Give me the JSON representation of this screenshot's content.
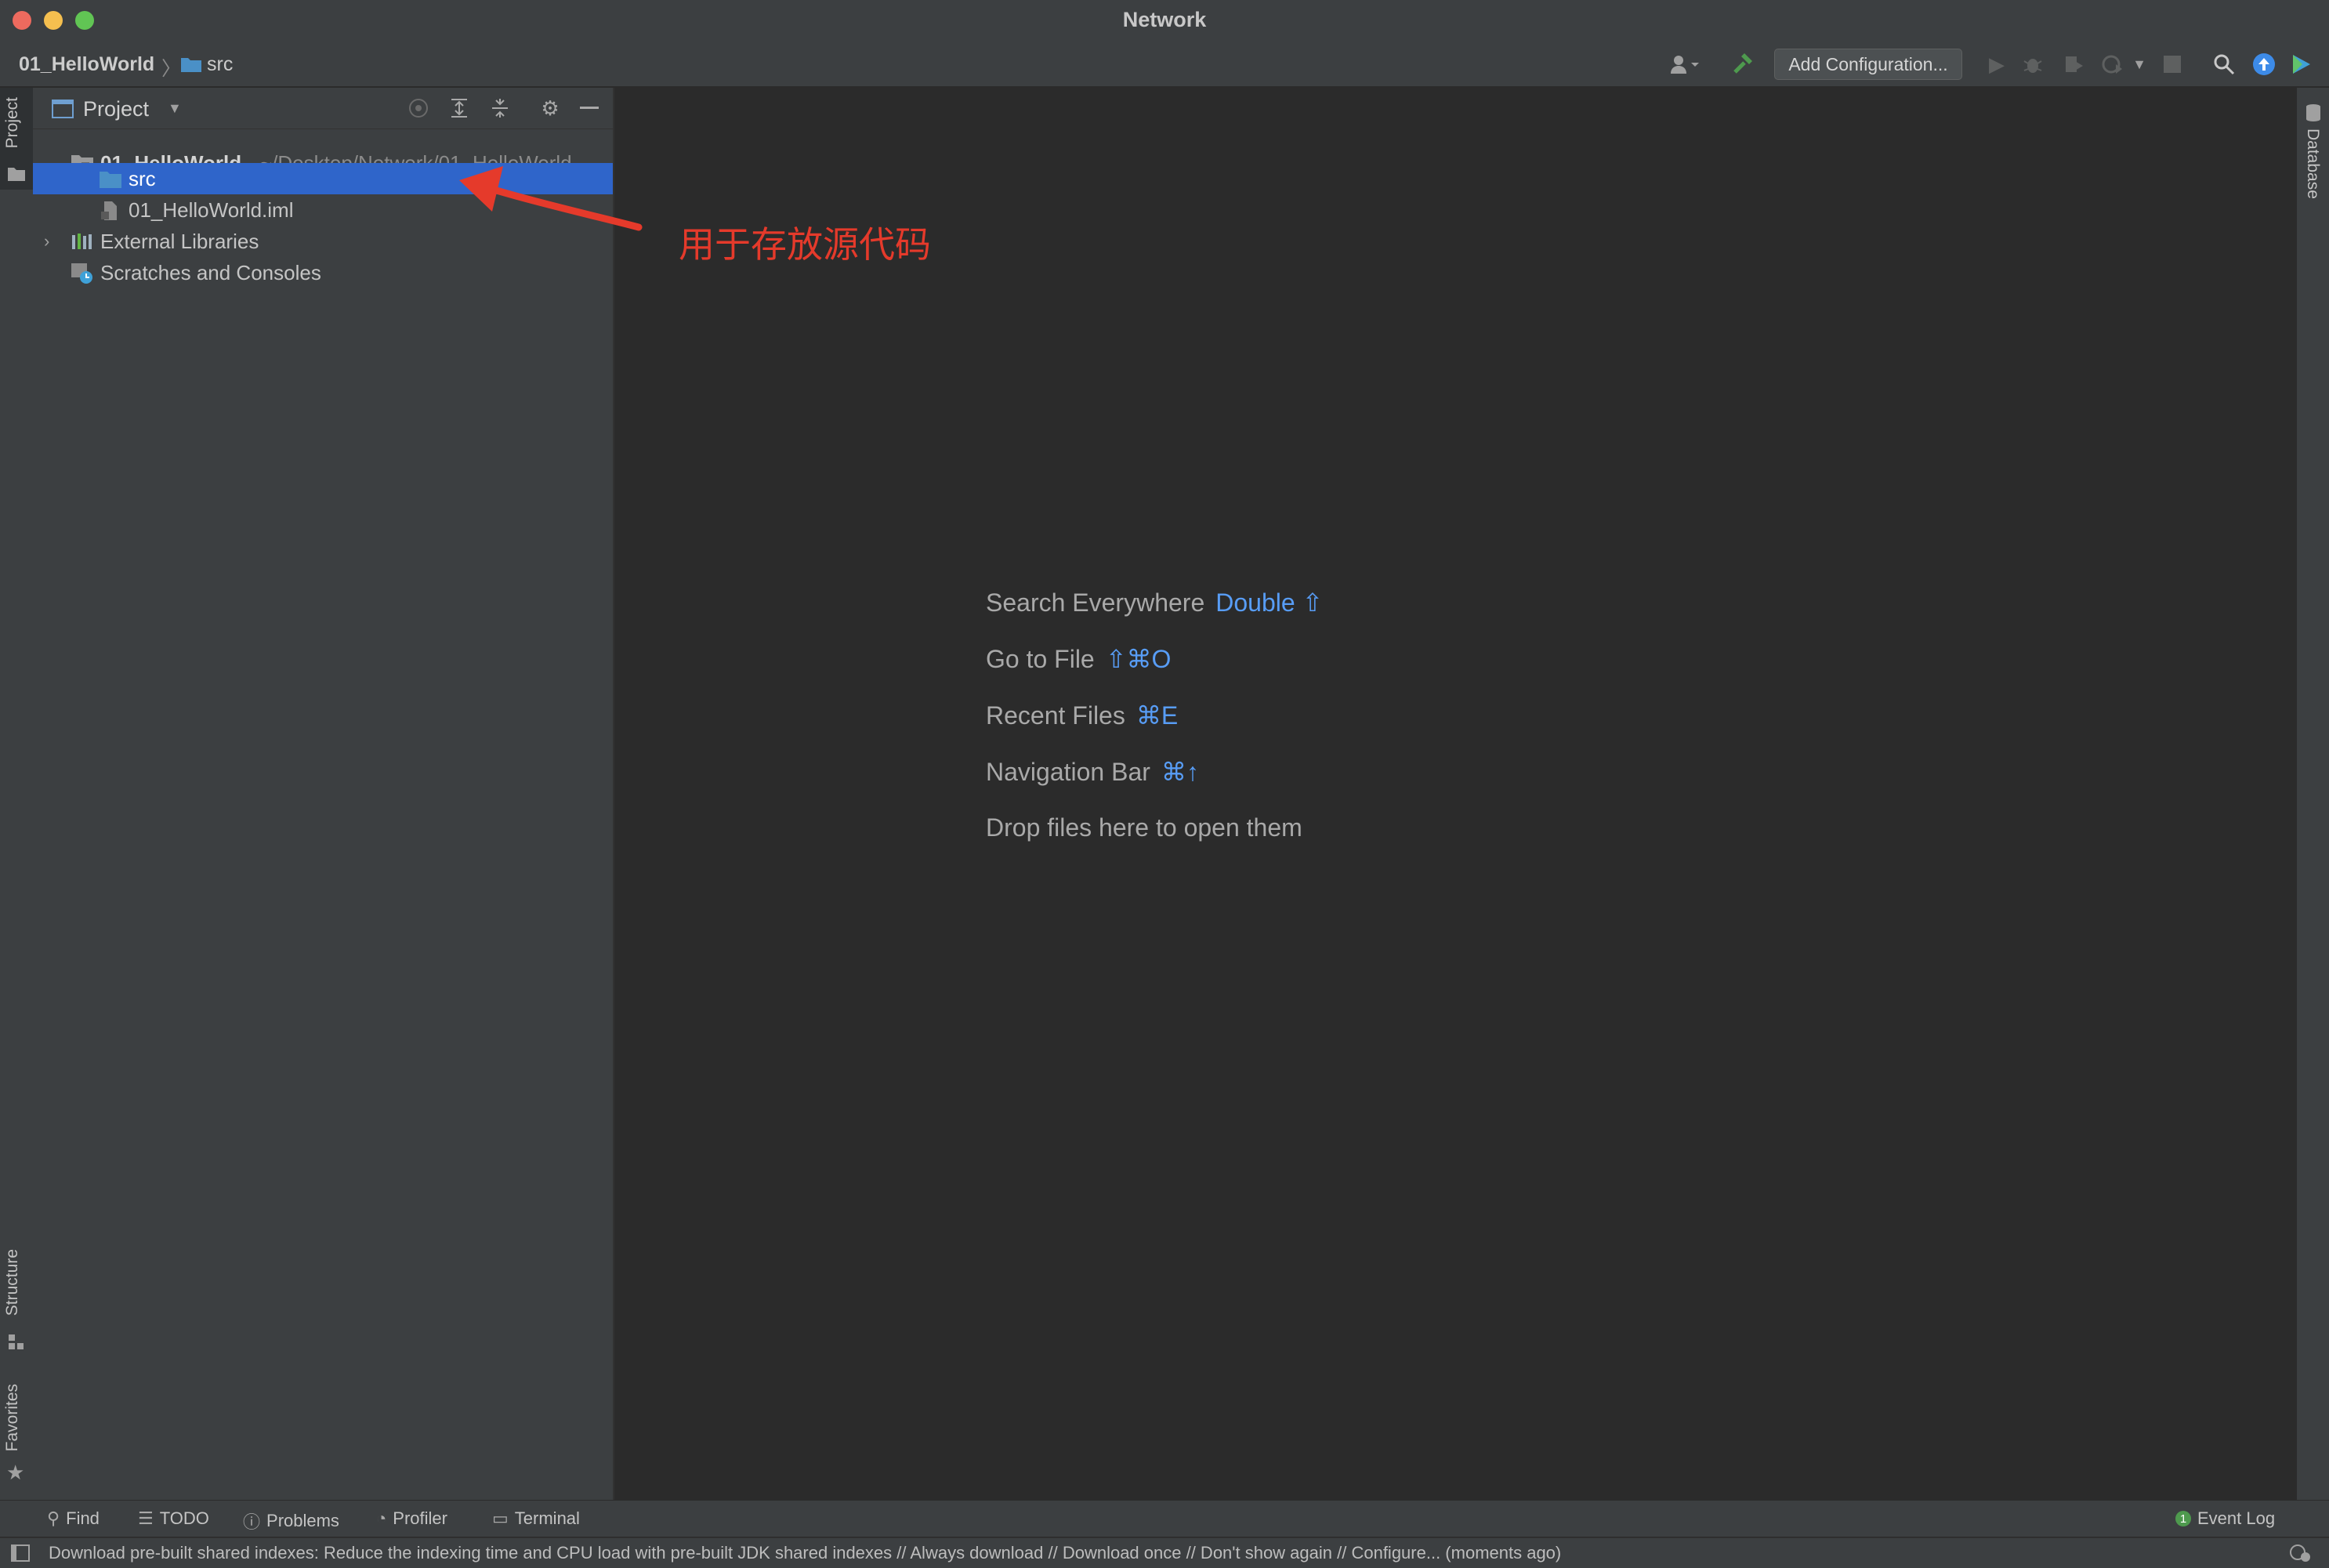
{
  "window": {
    "title": "Network"
  },
  "navbar": {
    "breadcrumb": [
      "01_HelloWorld",
      "src"
    ],
    "add_configuration": "Add Configuration..."
  },
  "project_panel": {
    "header_label": "Project",
    "tree": [
      {
        "label": "01_HelloWorld",
        "path": "~/Desktop/Network/01_HelloWorld",
        "expanded": true,
        "icon": "module-folder-icon"
      },
      {
        "label": "src",
        "selected": true,
        "icon": "source-folder-icon"
      },
      {
        "label": "01_HelloWorld.iml",
        "icon": "iml-file-icon"
      },
      {
        "label": "External Libraries",
        "expanded": false,
        "icon": "libraries-icon"
      },
      {
        "label": "Scratches and Consoles",
        "icon": "scratches-icon"
      }
    ]
  },
  "left_stripe": {
    "project": "Project",
    "structure": "Structure",
    "favorites": "Favorites"
  },
  "right_stripe": {
    "database": "Database"
  },
  "annotation": "用于存放源代码",
  "editor_hints": [
    {
      "label": "Search Everywhere",
      "shortcut": "Double ⇧"
    },
    {
      "label": "Go to File",
      "shortcut": "⇧⌘O"
    },
    {
      "label": "Recent Files",
      "shortcut": "⌘E"
    },
    {
      "label": "Navigation Bar",
      "shortcut": "⌘↑"
    },
    {
      "label": "Drop files here to open them",
      "shortcut": ""
    }
  ],
  "bottom_tabs": {
    "find": "Find",
    "todo": "TODO",
    "problems": "Problems",
    "profiler": "Profiler",
    "terminal": "Terminal",
    "event_log": "Event Log",
    "event_count": "1"
  },
  "status": "Download pre-built shared indexes: Reduce the indexing time and CPU load with pre-built JDK shared indexes // Always download // Download once // Don't show again // Configure... (moments ago)",
  "colors": {
    "selection": "#2f65ca",
    "accent_link": "#589df6",
    "annotation": "#e53a2b",
    "build_green": "#4e9a4e"
  }
}
